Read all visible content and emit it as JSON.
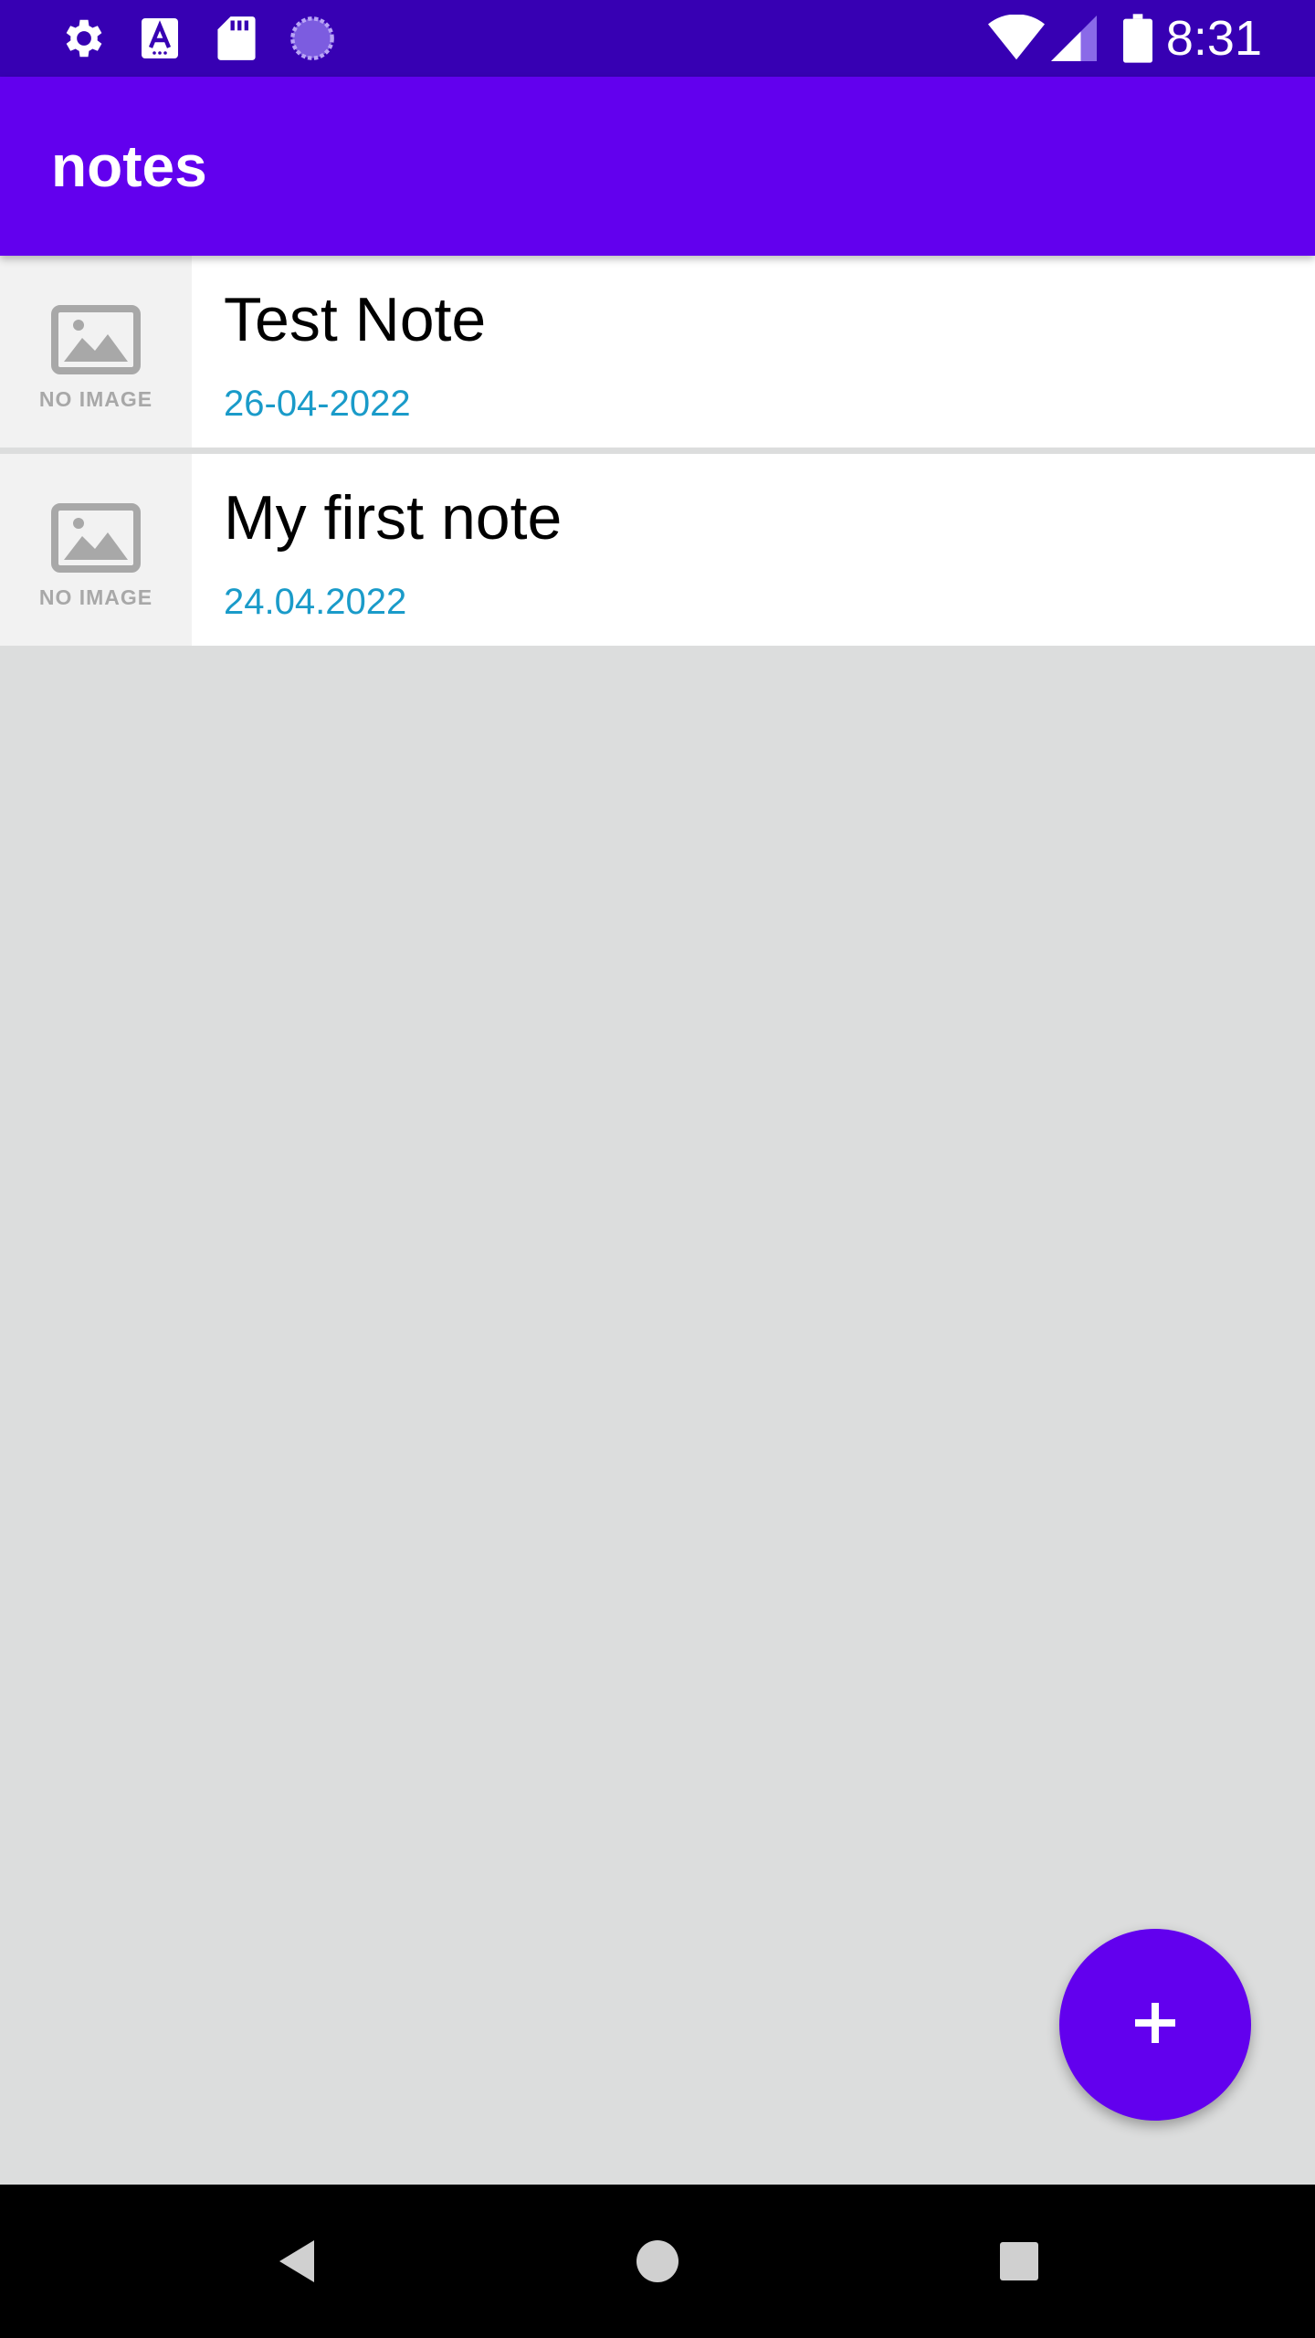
{
  "status_bar": {
    "time": "8:31",
    "icons": [
      "settings-icon",
      "keyboard-a-icon",
      "sd-card-icon",
      "sync-progress-icon",
      "wifi-icon",
      "signal-icon",
      "battery-icon"
    ]
  },
  "app_bar": {
    "title": "notes"
  },
  "notes": [
    {
      "title": "Test Note",
      "date": "26-04-2022",
      "thumbnail_label": "NO IMAGE"
    },
    {
      "title": "My first note",
      "date": "24.04.2022",
      "thumbnail_label": "NO IMAGE"
    }
  ],
  "fab": {
    "icon": "plus-icon",
    "label": "+"
  },
  "nav_bar": {
    "buttons": [
      "back-icon",
      "home-icon",
      "recents-icon"
    ]
  },
  "colors": {
    "status_bar": "#3700b3",
    "primary": "#6200ee",
    "date_text": "#1a9bc9",
    "background": "#dcdddd"
  }
}
